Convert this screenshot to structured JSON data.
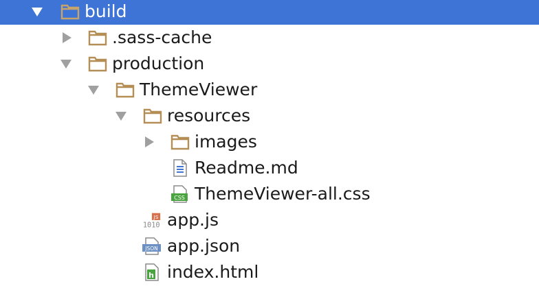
{
  "colors": {
    "selection": "#3d74d6",
    "folder_icon": "#b58e55",
    "toggle_arrow": "#a0a0a0",
    "text": "#1a1a1a",
    "css_badge": "#49a43f",
    "js_badge": "#d9704b",
    "json_badge": "#6c8fc4",
    "html_badge": "#49a43f"
  },
  "tree": [
    {
      "label": "build",
      "type": "folder",
      "expanded": true,
      "selected": true,
      "icon": "folder-icon"
    },
    {
      "label": ".sass-cache",
      "type": "folder",
      "expanded": false,
      "selected": false,
      "icon": "folder-icon"
    },
    {
      "label": "production",
      "type": "folder",
      "expanded": true,
      "selected": false,
      "icon": "folder-icon"
    },
    {
      "label": "ThemeViewer",
      "type": "folder",
      "expanded": true,
      "selected": false,
      "icon": "folder-icon"
    },
    {
      "label": "resources",
      "type": "folder",
      "expanded": true,
      "selected": false,
      "icon": "folder-icon"
    },
    {
      "label": "images",
      "type": "folder",
      "expanded": false,
      "selected": false,
      "icon": "folder-icon"
    },
    {
      "label": "Readme.md",
      "type": "file",
      "selected": false,
      "icon": "text-file-icon"
    },
    {
      "label": "ThemeViewer-all.css",
      "type": "file",
      "selected": false,
      "icon": "css-file-icon",
      "badge": "CSS"
    },
    {
      "label": "app.js",
      "type": "file",
      "selected": false,
      "icon": "js-file-icon",
      "badge": "JS",
      "icon_text": "1010"
    },
    {
      "label": "app.json",
      "type": "file",
      "selected": false,
      "icon": "json-file-icon",
      "badge": "JSON"
    },
    {
      "label": "index.html",
      "type": "file",
      "selected": false,
      "icon": "html-file-icon",
      "badge": "h"
    }
  ]
}
